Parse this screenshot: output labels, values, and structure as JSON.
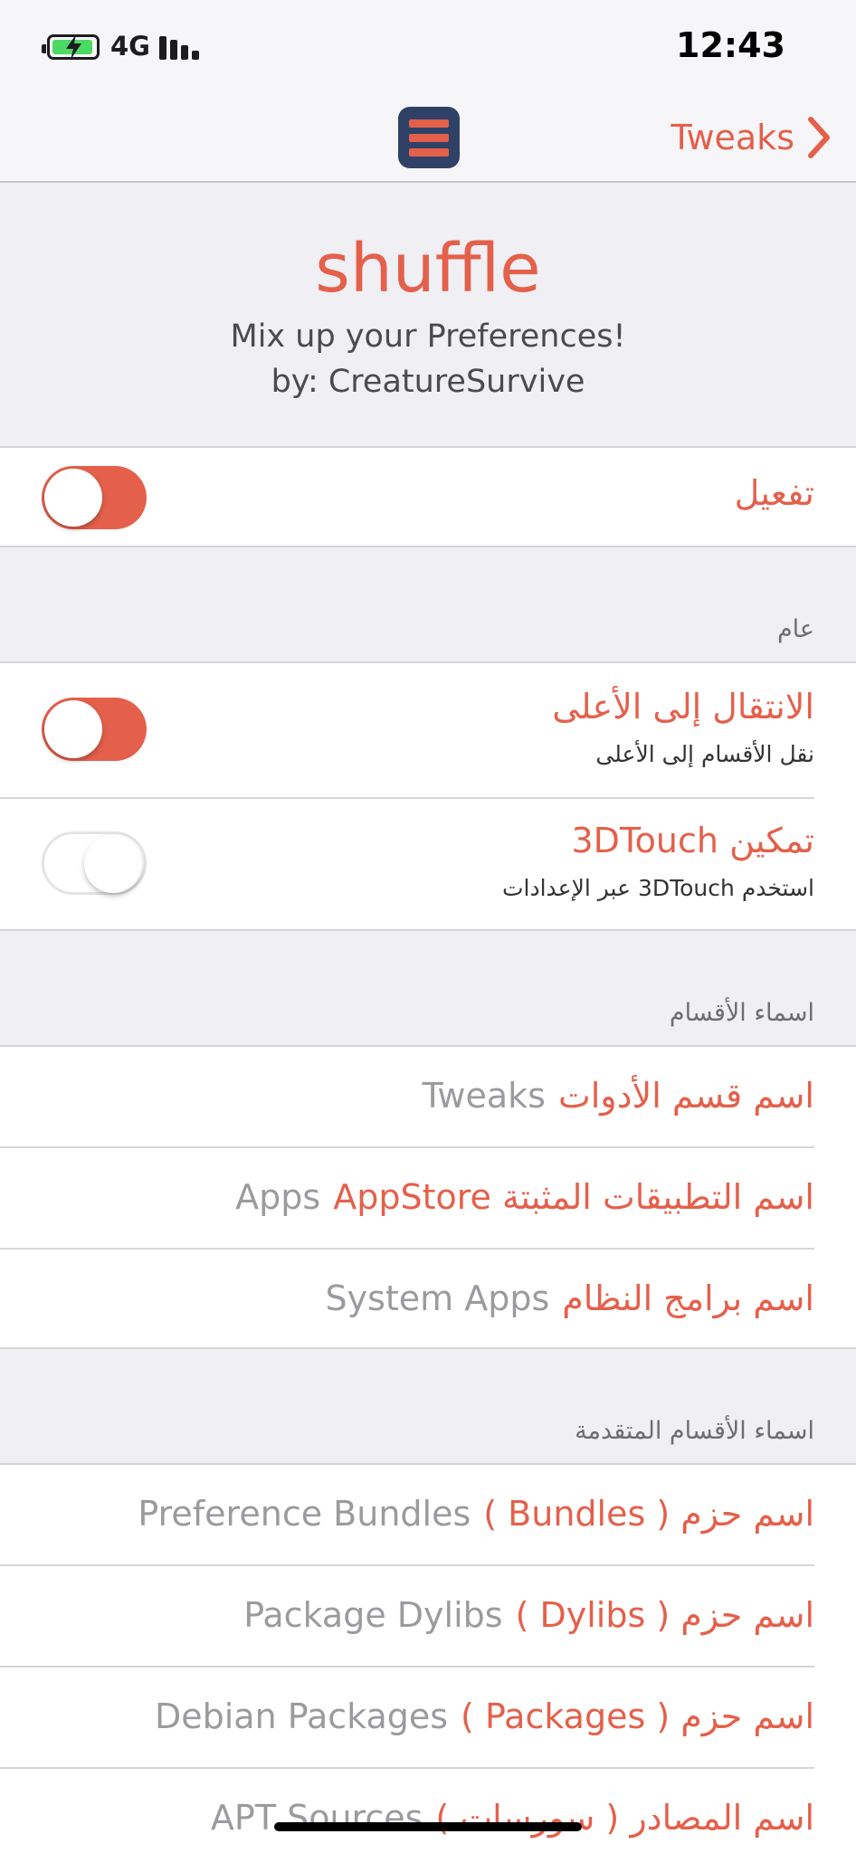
{
  "status_bar": {
    "network": "4G",
    "time": "12:43",
    "icons": [
      "battery-charging-icon",
      "signal-bars-icon"
    ]
  },
  "nav": {
    "app_icon": "hamburger-list-icon",
    "back_label": "Tweaks",
    "back_icon": "chevron-right-icon"
  },
  "header": {
    "title": "shuffle",
    "subtitle": "Mix up your Preferences!",
    "author": "by: CreatureSurvive"
  },
  "enable": {
    "label": "تفعيل",
    "on": true
  },
  "general": {
    "header": "عام",
    "rows": [
      {
        "title": "الانتقال إلى الأعلى",
        "subtitle": "نقل الأقسام إلى الأعلى",
        "on": true
      },
      {
        "title": "تمكين 3DTouch",
        "subtitle": "استخدم 3DTouch عبر الإعدادات",
        "on": false
      }
    ]
  },
  "section_names": {
    "header": "اسماء الأقسام",
    "rows": [
      {
        "label": "اسم قسم الأدوات",
        "value": "Tweaks"
      },
      {
        "label": "اسم التطبيقات المثبتة AppStore",
        "value": "Apps"
      },
      {
        "label": "اسم برامج النظام",
        "value": "System Apps"
      }
    ]
  },
  "advanced_names": {
    "header": "اسماء الأقسام المتقدمة",
    "rows": [
      {
        "label": "اسم حزم ( Bundles )",
        "value": "Preference Bundles"
      },
      {
        "label": "اسم حزم ( Dylibs )",
        "value": "Package Dylibs"
      },
      {
        "label": "اسم حزم ( Packages )",
        "value": "Debian Packages"
      },
      {
        "label": "اسم المصادر ( سورسات )",
        "value": "APT Sources"
      }
    ]
  },
  "colors": {
    "accent": "#e4604b",
    "background": "#efeff4",
    "app_icon_bg": "#2f4167"
  }
}
